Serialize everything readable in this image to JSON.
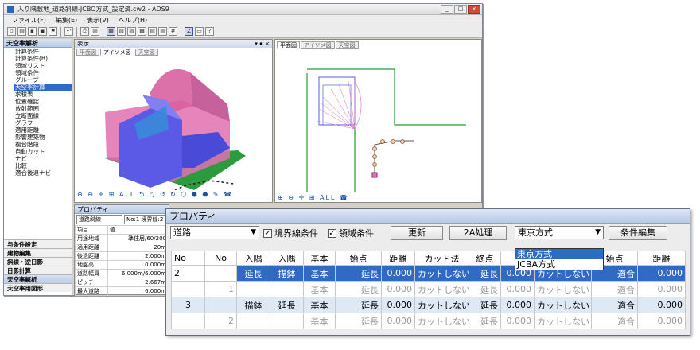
{
  "app": {
    "title": "入り隅敷地_道路斜線-JCBO方式_設定済.cw2 - ADS9",
    "menu": [
      "ファイル(F)",
      "編集(E)",
      "表示(V)",
      "ヘルプ(H)"
    ],
    "toolbar_labels": {
      "z": "Z",
      "help": "?"
    }
  },
  "sidebar": {
    "header": "天空率解析",
    "items": [
      "計算条件",
      "計算条件(B)",
      "領域リスト",
      "領域条件",
      "グループ",
      "天空率計算",
      "求積表",
      "位置確認",
      "放射範囲",
      "立断面線",
      "グラフ",
      "適用距離",
      "影響建築物",
      "複合階段",
      "自動カット",
      "ナビ",
      "比較",
      "適合後退ナビ"
    ],
    "selected_index": 5,
    "bottom": [
      "与条件設定",
      "建物編集",
      "斜線・逆日影",
      "日影計算",
      "天空率解析",
      "天空率用図形"
    ],
    "bottom_active_index": 4
  },
  "view_left": {
    "header": "表示",
    "controls": "▾ ▪ ×",
    "tabs": [
      "平面図",
      "アイソメ図",
      "天空図"
    ],
    "selected_tab": 1,
    "footer": "⊕ ⊖ ✛ ⊞ ALL ⮌ ⮎ ↺ ↻ ⬡ ⬢ ⬣ ✎ ☎"
  },
  "view_right": {
    "tabs": [
      "平面図",
      "アイソメ図",
      "天空図"
    ],
    "selected_tab": 0,
    "footer": "⊕ ⊖ ✛ ⊞ ALL ☎"
  },
  "props_back": {
    "header": "プロパティ",
    "combo": "道路斜線",
    "combo2": "No:1 境界線:2",
    "col_headers": [
      "項目",
      "値"
    ],
    "rows": [
      [
        "用途地域",
        "準住居/60/200"
      ],
      [
        "適用距離",
        "20m"
      ],
      [
        "後退距離",
        "2.000m"
      ],
      [
        "地盤高",
        "0.000m"
      ],
      [
        "道路幅員",
        "6.000m/6.000m"
      ],
      [
        "ピッチ",
        "2.667m"
      ],
      [
        "最大道路",
        "6.000m"
      ]
    ]
  },
  "properties": {
    "title": "プロパティ",
    "type_combo": "道路",
    "checkbox1": {
      "label": "境界線条件",
      "checked": true,
      "mark": "✓"
    },
    "checkbox2": {
      "label": "領域条件",
      "checked": true,
      "mark": "✓"
    },
    "btn_update": "更新",
    "btn_2a": "2A処理",
    "method_combo": "東京方式",
    "dropdown_options": [
      "東京方式",
      "JCBA方式"
    ],
    "dropdown_selected": 0,
    "btn_cond": "条件編集",
    "headers": [
      "No",
      "No",
      "入隅",
      "入隅",
      "基本",
      "始点",
      "距離",
      "カット法",
      "終点",
      "",
      "",
      "始点",
      "距離"
    ],
    "rows": [
      [
        "2",
        "",
        "延長",
        "描鉢",
        "基本",
        "延長",
        "0.000",
        "カットしない",
        "延長",
        "0.000",
        "カットしない",
        "適合",
        "0.000"
      ],
      [
        "",
        "1",
        "",
        "",
        "基本",
        "延長",
        "0.000",
        "カットしない",
        "延長",
        "0.000",
        "カットしない",
        "適合",
        "0.000"
      ],
      [
        "3",
        "",
        "描鉢",
        "延長",
        "基本",
        "延長",
        "0.000",
        "カットしない",
        "延長",
        "0.000",
        "カットしない",
        "適合",
        "0.000"
      ],
      [
        "",
        "2",
        "",
        "",
        "基本",
        "延長",
        "0.000",
        "カットしない",
        "延長",
        "0.000",
        "カットしない",
        "適合",
        "0.000"
      ]
    ]
  },
  "colors": {
    "highlight": "#316ac5",
    "building_blue": "#5a5ae6",
    "envelope_pink": "#e070b0",
    "ground_green": "#2e9a3e",
    "boundary_green": "#1fa02f"
  }
}
